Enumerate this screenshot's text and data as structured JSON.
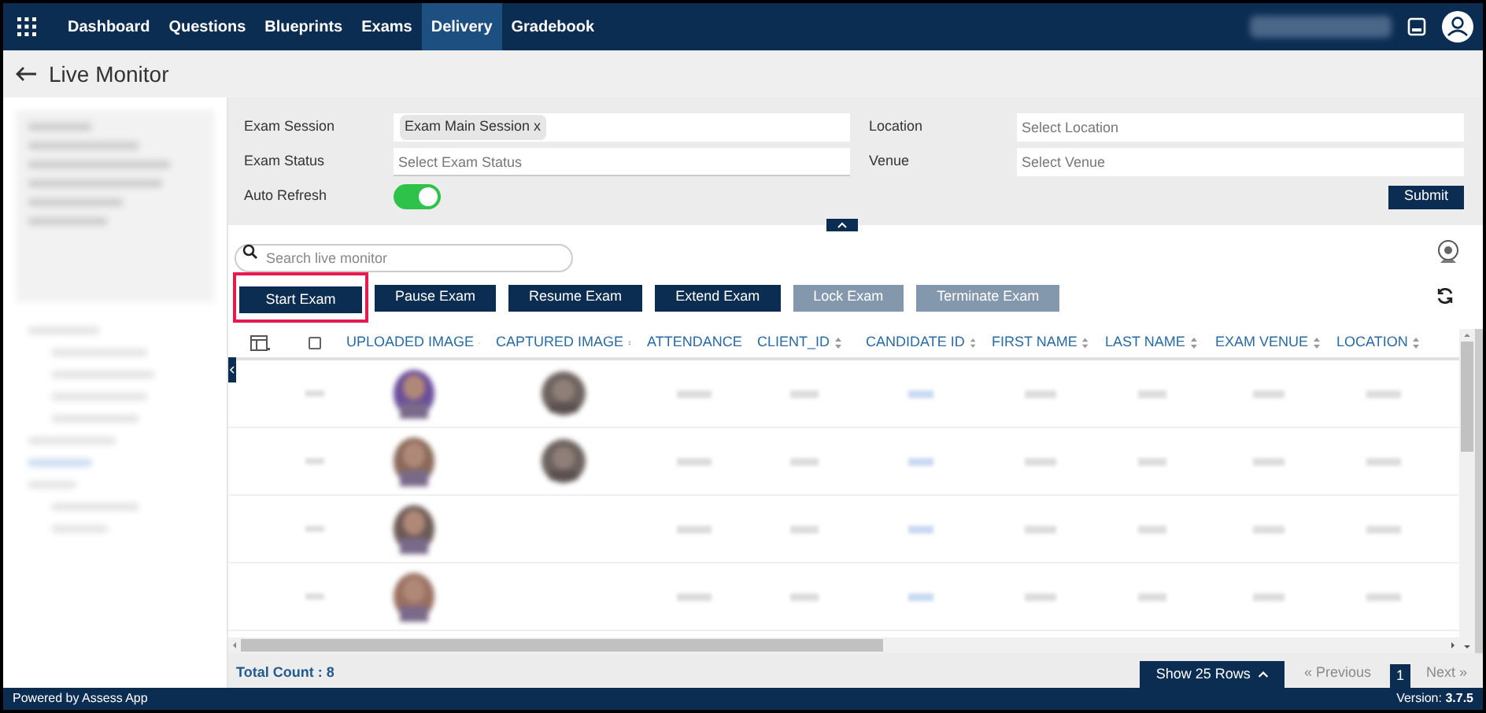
{
  "nav": {
    "items": [
      {
        "label": "Dashboard",
        "selected": false
      },
      {
        "label": "Questions",
        "selected": false
      },
      {
        "label": "Blueprints",
        "selected": false
      },
      {
        "label": "Exams",
        "selected": false
      },
      {
        "label": "Delivery",
        "selected": true
      },
      {
        "label": "Gradebook",
        "selected": false
      }
    ]
  },
  "page_title": "Live Monitor",
  "filters": {
    "exam_session": {
      "label": "Exam Session",
      "chip": "Exam Main Session x"
    },
    "exam_status": {
      "label": "Exam Status",
      "placeholder": "Select Exam Status"
    },
    "auto_refresh": {
      "label": "Auto Refresh",
      "on": true
    },
    "location": {
      "label": "Location",
      "placeholder": "Select Location"
    },
    "venue": {
      "label": "Venue",
      "placeholder": "Select Venue"
    },
    "submit": "Submit"
  },
  "search": {
    "placeholder": "Search live monitor"
  },
  "actions": [
    {
      "label": "Start Exam",
      "disabled": false,
      "highlighted": true
    },
    {
      "label": "Pause Exam",
      "disabled": false,
      "highlighted": false
    },
    {
      "label": "Resume Exam",
      "disabled": false,
      "highlighted": false
    },
    {
      "label": "Extend Exam",
      "disabled": false,
      "highlighted": false
    },
    {
      "label": "Lock Exam",
      "disabled": true,
      "highlighted": false
    },
    {
      "label": "Terminate Exam",
      "disabled": true,
      "highlighted": false
    }
  ],
  "table": {
    "select_all_checked": false,
    "columns": [
      "UPLOADED IMAGE",
      "CAPTURED IMAGE",
      "ATTENDANCE",
      "CLIENT_ID",
      "CANDIDATE ID",
      "FIRST NAME",
      "LAST NAME",
      "EXAM VENUE",
      "LOCATION"
    ],
    "rows": [
      {
        "has_captured_image": true
      },
      {
        "has_captured_image": true
      },
      {
        "has_captured_image": false
      },
      {
        "has_captured_image": false
      }
    ]
  },
  "total_count": "Total Count : 8",
  "pagination": {
    "rows_button": "Show 25 Rows",
    "previous": "« Previous",
    "page": "1",
    "next": "Next »"
  },
  "footer": {
    "powered_by": "Powered by Assess App",
    "version_label": "Version: ",
    "version": "3.7.5"
  }
}
